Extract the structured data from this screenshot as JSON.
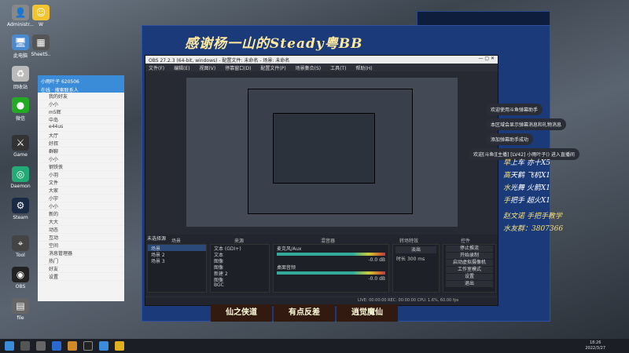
{
  "banner": {
    "title": "感谢杨一山的Steady粤BB"
  },
  "obs": {
    "title": "OBS 27.2.3 (64-bit, windows) - 配置文件: 未命名 - 场景: 未命名",
    "menus": [
      "文件(F)",
      "编辑(E)",
      "视图(V)",
      "停靠窗口(D)",
      "配置文件(P)",
      "场景集合(S)",
      "工具(T)",
      "帮助(H)"
    ],
    "no_source": "未选择源",
    "scenes_title": "场景",
    "scenes": [
      "场景",
      "场景 2",
      "场景 3"
    ],
    "sources_title": "来源",
    "sources": [
      "文本 (GDI+)",
      "文本",
      "图像",
      "图像",
      "新建 2",
      "图像",
      "BGC"
    ],
    "mixer_title": "混音器",
    "mixer": [
      "麦克风/Aux",
      "桌面音频"
    ],
    "mixer_levels": [
      "-0.0 dB",
      "-0.0 dB"
    ],
    "transition_title": "转场特效",
    "transition": "淡出",
    "duration_label": "时长",
    "duration": "300 ms",
    "controls_title": "控件",
    "controls": [
      "停止推流",
      "开始录制",
      "启动虚拟摄像机",
      "工作室模式",
      "设置",
      "退出"
    ],
    "status": "LIVE: 00:00:00   REC: 00:00:00   CPU: 1.6%, 60.00 fps"
  },
  "qq": {
    "header": "小雨叶子",
    "id": "620506",
    "search": "搜索联系人",
    "status": "在线",
    "items": [
      "我的好友",
      "小小",
      "m5辉",
      "中岛",
      "e44us",
      "大厅",
      "好叔",
      "群聊",
      "小小",
      "钢铁侠",
      "小羽",
      "文件",
      "大家",
      "小宇",
      "小小",
      "新的",
      "大大",
      "动态",
      "互动",
      "空间",
      "消息管理器",
      "热门",
      "好友",
      "设置"
    ]
  },
  "chat": [
    "欢迎使用斗鱼弹幕助手",
    "本区域会显示弹幕消息和礼物消息",
    "添加弹幕助手成功",
    "欢迎[斗鱼][主播] [LV42] 小雨叶子() 进入直播间"
  ],
  "right_text": [
    {
      "k": "早",
      "v": "上车 亦十X5"
    },
    {
      "k": "高",
      "v": "天鹤 飞机X1"
    },
    {
      "k": "水",
      "v": "光舞 火箭X1"
    },
    {
      "k": "手",
      "v": "把手 超火X1"
    }
  ],
  "right_footer_1": "赵文诺 手把手教学",
  "right_footer_2": "水友群：3807366",
  "thumbs": [
    "仙之侠道",
    "有点反差",
    "逍觉魔仙"
  ],
  "taskbar": {
    "time": "18:26",
    "date": "2022/3/27"
  }
}
